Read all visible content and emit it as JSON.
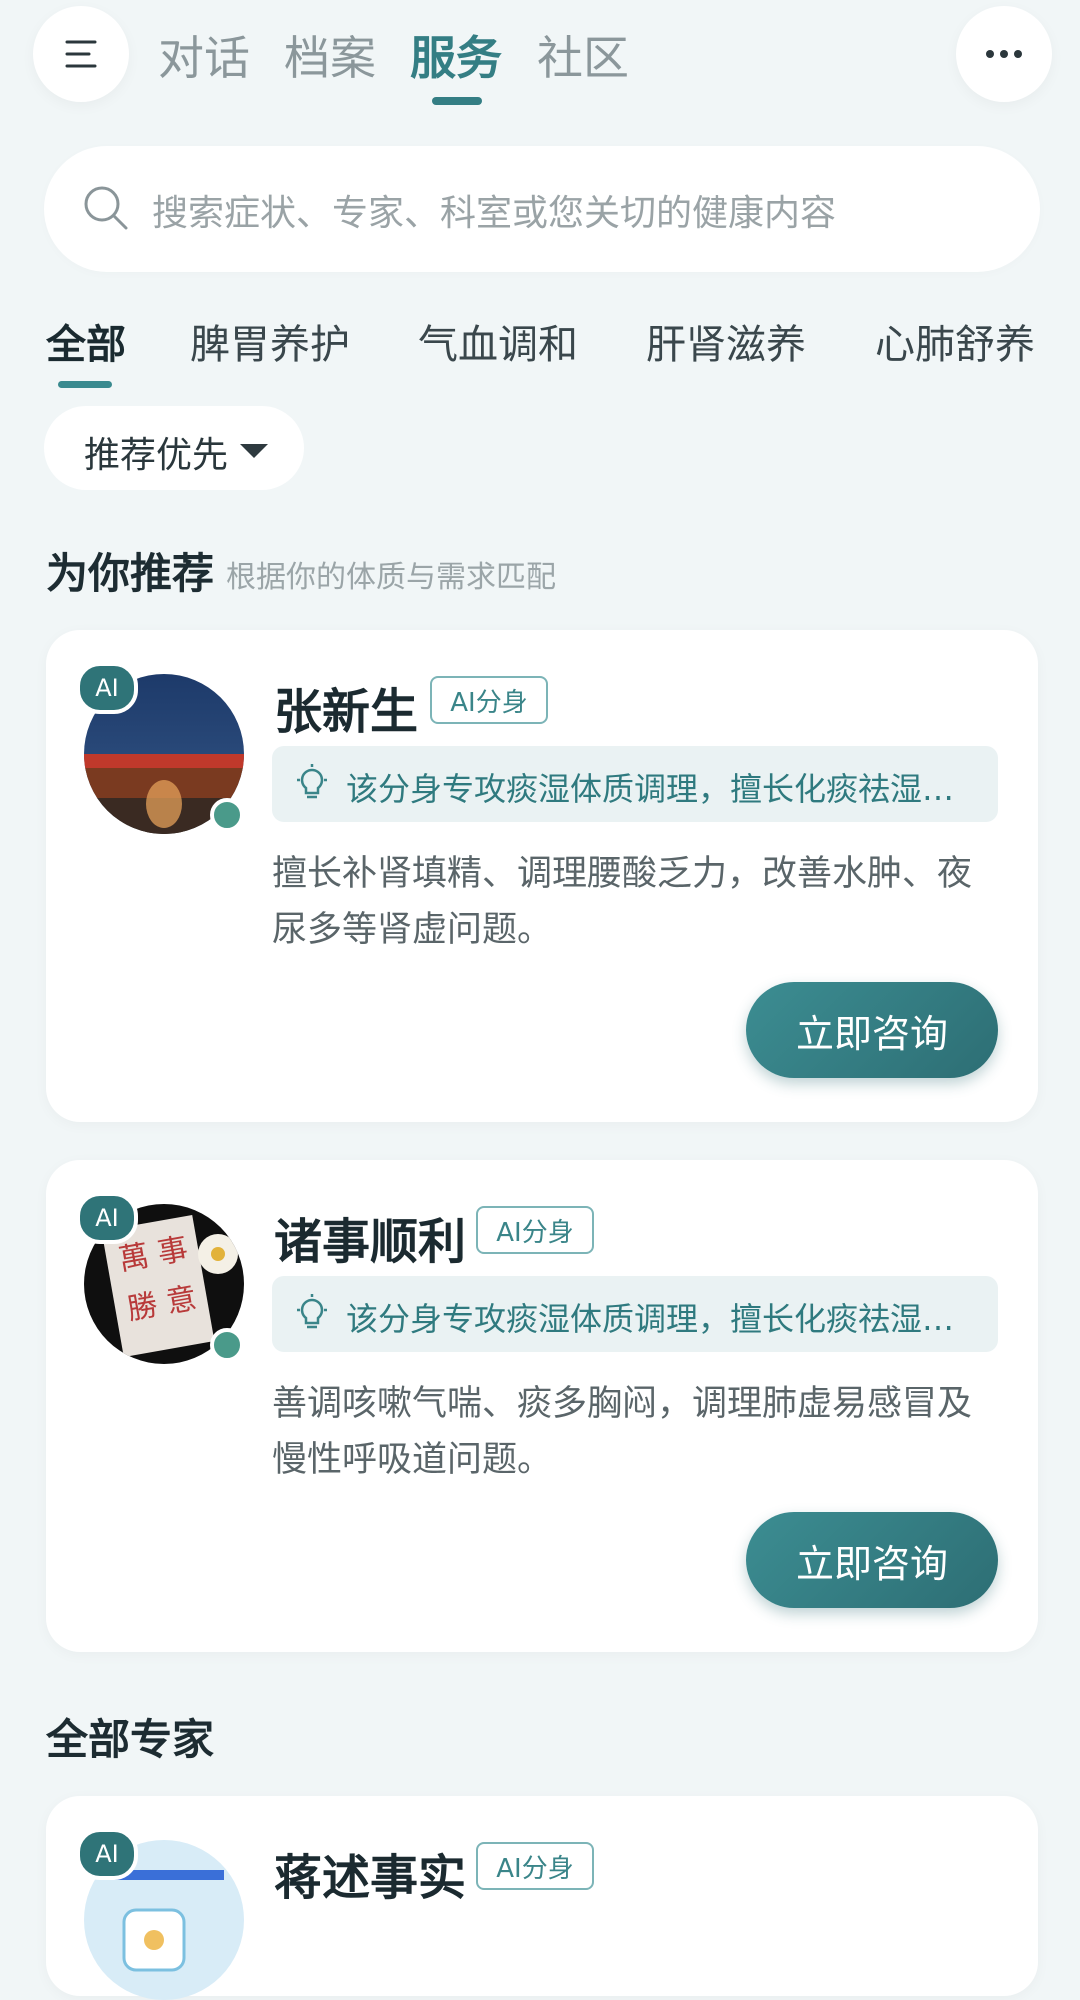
{
  "top_nav": {
    "tabs": [
      {
        "label": "对话",
        "active": false
      },
      {
        "label": "档案",
        "active": false
      },
      {
        "label": "服务",
        "active": true
      },
      {
        "label": "社区",
        "active": false
      }
    ],
    "menu_icon": "hamburger-icon",
    "more_icon": "more-horizontal-icon",
    "accent_color": "#347e84"
  },
  "search": {
    "placeholder": "搜索症状、专家、科室或您关切的健康内容",
    "icon": "search-icon"
  },
  "categories": [
    {
      "label": "全部",
      "active": true
    },
    {
      "label": "脾胃养护",
      "active": false
    },
    {
      "label": "气血调和",
      "active": false
    },
    {
      "label": "肝肾滋养",
      "active": false
    },
    {
      "label": "心肺舒养",
      "active": false
    }
  ],
  "sort": {
    "label": "推荐优先",
    "icon": "caret-down-icon"
  },
  "recommend": {
    "title": "为你推荐",
    "subtitle": "根据你的体质与需求匹配"
  },
  "cards": [
    {
      "badge": "AI",
      "name": "张新生",
      "tag": "AI分身",
      "tip": "该分身专攻痰湿体质调理，擅长化痰祛湿…",
      "desc": "擅长补肾填精、调理腰酸乏力，改善水肿、夜尿多等肾虚问题。",
      "button": "立即咨询",
      "online": true
    },
    {
      "badge": "AI",
      "name": "诸事顺利",
      "tag": "AI分身",
      "tip": "该分身专攻痰湿体质调理，擅长化痰祛湿…",
      "desc": "善调咳嗽气喘、痰多胸闷，调理肺虚易感冒及慢性呼吸道问题。",
      "button": "立即咨询",
      "online": true
    }
  ],
  "all_experts": {
    "title": "全部专家",
    "first": {
      "badge": "AI",
      "name": "蒋述事实",
      "tag": "AI分身"
    }
  }
}
